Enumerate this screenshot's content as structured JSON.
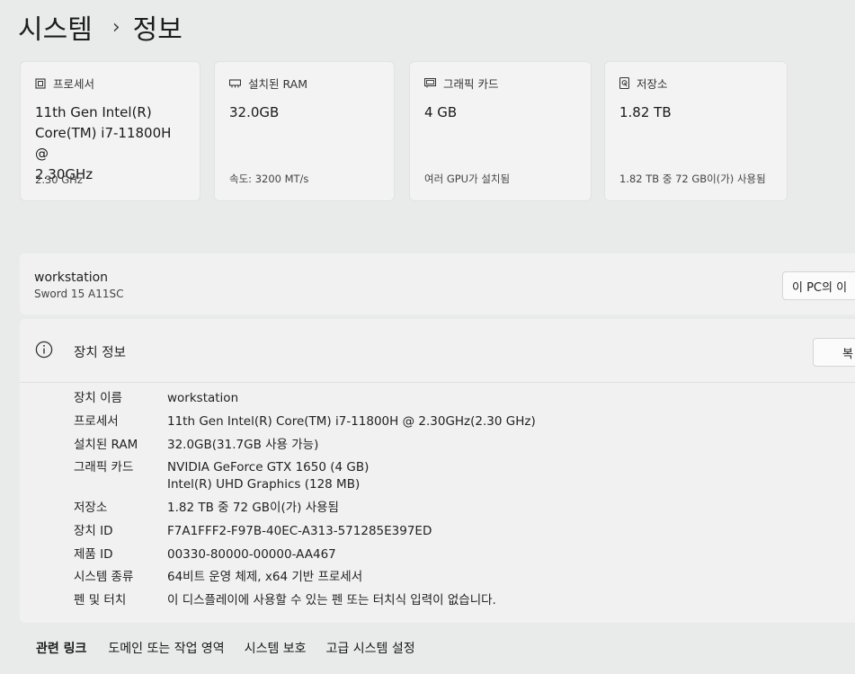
{
  "breadcrumb": {
    "parent": "시스템",
    "current": "정보"
  },
  "cards": [
    {
      "icon": "processor-icon",
      "label": "프로세서",
      "value_lines": [
        "11th Gen Intel(R)",
        "Core(TM) i7-11800H @",
        "2.30GHz"
      ],
      "sub": "2.30 GHz"
    },
    {
      "icon": "ram-icon",
      "label": "설치된 RAM",
      "value_lines": [
        "32.0GB"
      ],
      "sub": "속도: 3200 MT/s"
    },
    {
      "icon": "graphics-card-icon",
      "label": "그래픽 카드",
      "value_lines": [
        "4 GB"
      ],
      "sub": "여러 GPU가 설치됨"
    },
    {
      "icon": "storage-icon",
      "label": "저장소",
      "value_lines": [
        "1.82 TB"
      ],
      "sub": "1.82 TB 중 72 GB이(가) 사용됨"
    }
  ],
  "pc": {
    "name": "workstation",
    "model": "Sword 15 A11SC",
    "rename_button": "이 PC의 이"
  },
  "specs": {
    "title": "장치 정보",
    "copy_button": "복",
    "rows": [
      {
        "label": "장치 이름",
        "values": [
          "workstation"
        ]
      },
      {
        "label": "프로세서",
        "values": [
          "11th Gen Intel(R) Core(TM) i7-11800H @ 2.30GHz(2.30 GHz)"
        ]
      },
      {
        "label": "설치된 RAM",
        "values": [
          "32.0GB(31.7GB 사용 가능)"
        ]
      },
      {
        "label": "그래픽 카드",
        "values": [
          "NVIDIA GeForce GTX 1650 (4 GB)",
          "Intel(R) UHD Graphics (128 MB)"
        ]
      },
      {
        "label": "저장소",
        "values": [
          "1.82 TB 중 72 GB이(가) 사용됨"
        ]
      },
      {
        "label": "장치 ID",
        "values": [
          "F7A1FFF2-F97B-40EC-A313-571285E397ED"
        ]
      },
      {
        "label": "제품 ID",
        "values": [
          "00330-80000-00000-AA467"
        ]
      },
      {
        "label": "시스템 종류",
        "values": [
          "64비트 운영 체제, x64 기반 프로세서"
        ]
      },
      {
        "label": "펜 및 터치",
        "values": [
          "이 디스플레이에 사용할 수 있는 펜 또는 터치식 입력이 없습니다."
        ]
      }
    ]
  },
  "related": {
    "header": "관련 링크",
    "links": [
      "도메인 또는 작업 영역",
      "시스템 보호",
      "고급 시스템 설정"
    ]
  }
}
